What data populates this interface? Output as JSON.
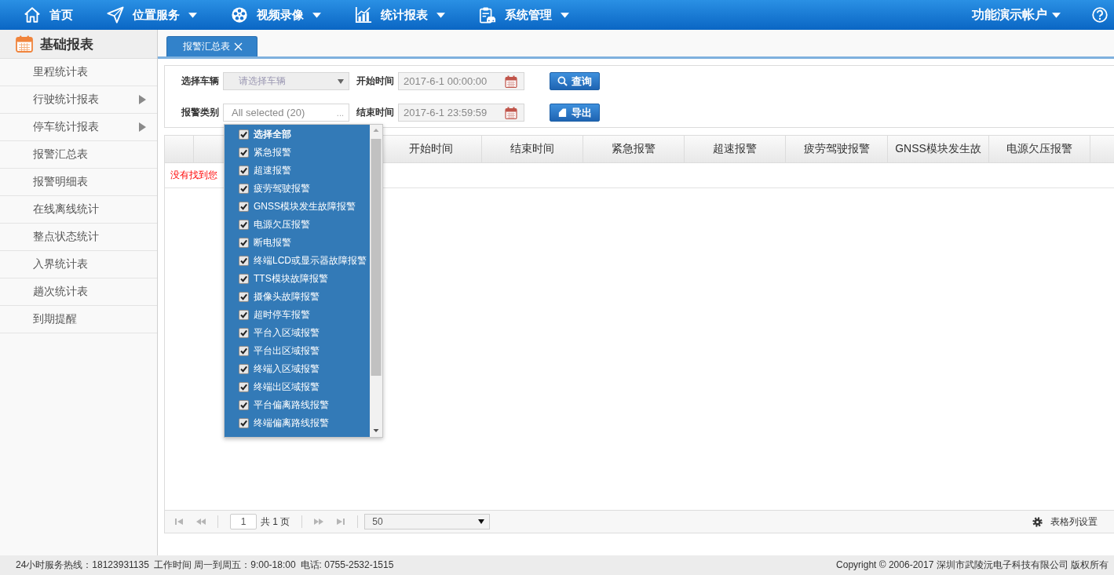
{
  "top_nav": {
    "items": [
      {
        "label": "首页",
        "dropdown": false
      },
      {
        "label": "位置服务",
        "dropdown": true
      },
      {
        "label": "视频录像",
        "dropdown": true
      },
      {
        "label": "统计报表",
        "dropdown": true
      },
      {
        "label": "系统管理",
        "dropdown": true
      }
    ],
    "account": {
      "label": "功能演示帐户",
      "dropdown": true
    }
  },
  "sidebar": {
    "title": "基础报表",
    "items": [
      {
        "label": "里程统计表",
        "submenu": false
      },
      {
        "label": "行驶统计报表",
        "submenu": true
      },
      {
        "label": "停车统计报表",
        "submenu": true
      },
      {
        "label": "报警汇总表",
        "submenu": false
      },
      {
        "label": "报警明细表",
        "submenu": false
      },
      {
        "label": "在线离线统计",
        "submenu": false
      },
      {
        "label": "整点状态统计",
        "submenu": false
      },
      {
        "label": "入界统计表",
        "submenu": false
      },
      {
        "label": "趟次统计表",
        "submenu": false
      },
      {
        "label": "到期提醒",
        "submenu": false
      }
    ]
  },
  "tabs": [
    {
      "label": "报警汇总表",
      "selected": true
    }
  ],
  "filters": {
    "vehicle": {
      "label": "选择车辆",
      "placeholder": "请选择车辆"
    },
    "start_time": {
      "label": "开始时间",
      "value": "2017-6-1 00:00:00"
    },
    "query_button": "查询",
    "alarm_type": {
      "label": "报警类别",
      "value": "All selected (20)",
      "more": "...",
      "open": true,
      "options": [
        {
          "label": "选择全部",
          "kind": "select_all",
          "checked": true
        },
        {
          "label": "紧急报警",
          "kind": "option",
          "checked": true
        },
        {
          "label": "超速报警",
          "kind": "option",
          "checked": true
        },
        {
          "label": "疲劳驾驶报警",
          "kind": "option",
          "checked": true
        },
        {
          "label": "GNSS模块发生故障报警",
          "kind": "option",
          "checked": true
        },
        {
          "label": "电源欠压报警",
          "kind": "option",
          "checked": true
        },
        {
          "label": "断电报警",
          "kind": "option",
          "checked": true
        },
        {
          "label": "终端LCD或显示器故障报警",
          "kind": "option",
          "checked": true
        },
        {
          "label": "TTS模块故障报警",
          "kind": "option",
          "checked": true
        },
        {
          "label": "摄像头故障报警",
          "kind": "option",
          "checked": true
        },
        {
          "label": "超时停车报警",
          "kind": "option",
          "checked": true
        },
        {
          "label": "平台入区域报警",
          "kind": "option",
          "checked": true
        },
        {
          "label": "平台出区域报警",
          "kind": "option",
          "checked": true
        },
        {
          "label": "终端入区域报警",
          "kind": "option",
          "checked": true
        },
        {
          "label": "终端出区域报警",
          "kind": "option",
          "checked": true
        },
        {
          "label": "平台偏离路线报警",
          "kind": "option",
          "checked": true
        },
        {
          "label": "终端偏离路线报警",
          "kind": "option",
          "checked": true
        }
      ]
    },
    "end_time": {
      "label": "结束时间",
      "value": "2017-6-1 23:59:59"
    },
    "export_button": "导出"
  },
  "table": {
    "columns": [
      "开始时间",
      "结束时间",
      "紧急报警",
      "超速报警",
      "疲劳驾驶报警",
      "GNSS模块发生故",
      "电源欠压报警"
    ],
    "message": "没有找到您"
  },
  "pagination": {
    "page": "1",
    "page_count": "共 1 页",
    "page_size": "50",
    "nav_disabled": true,
    "settings_label": "表格列设置"
  },
  "footer": {
    "contact": [
      "24小时服务热线：18123931135",
      "工作时间 周一到周五：9:00-18:00",
      "电话: 0755-2532-1515"
    ],
    "copyright": "Copyright © 2006-2017 深圳市武陵沅电子科技有限公司 版权所有"
  }
}
